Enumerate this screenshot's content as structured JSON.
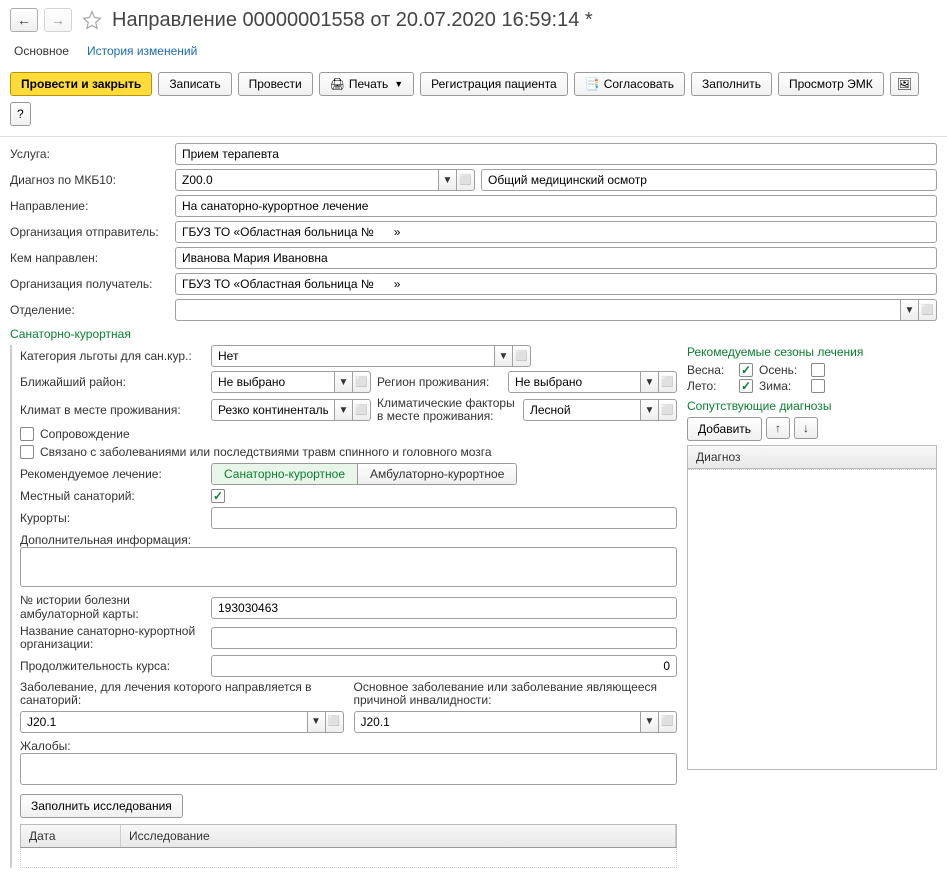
{
  "title": "Направление 00000001558 от 20.07.2020 16:59:14 *",
  "tabs": {
    "main": "Основное",
    "history": "История изменений"
  },
  "toolbar": {
    "post_close": "Провести и закрыть",
    "save": "Записать",
    "post": "Провести",
    "print": "Печать",
    "register": "Регистрация пациента",
    "approve": "Согласовать",
    "fill": "Заполнить",
    "view_emk": "Просмотр ЭМК",
    "help": "?"
  },
  "form": {
    "service_label": "Услуга:",
    "service": "Прием терапевта",
    "mkb_label": "Диагноз по МКБ10:",
    "mkb": "Z00.0",
    "mkb_desc": "Общий медицинский осмотр",
    "direction_label": "Направление:",
    "direction": "На санаторно-курортное лечение",
    "org_sender_label": "Организация отправитель:",
    "org_sender": "ГБУЗ ТО «Областная больница №      »",
    "sent_by_label": "Кем направлен:",
    "sent_by": "Иванова Мария Ивановна",
    "org_recv_label": "Организация получатель:",
    "org_recv": "ГБУЗ ТО «Областная больница №      »",
    "dept_label": "Отделение:",
    "dept": ""
  },
  "section_title": "Санаторно-курортная",
  "sk": {
    "benefit_label": "Категория льготы для сан.кур.:",
    "benefit": "Нет",
    "nearest_label": "Ближайший район:",
    "nearest": "Не выбрано",
    "region_label": "Регион проживания:",
    "region": "Не выбрано",
    "climate_label": "Климат в месте проживания:",
    "climate": "Резко континентальный",
    "factors_label": "Климатические факторы в месте проживания:",
    "factors": "Лесной",
    "escort_label": "Сопровождение",
    "spinal_label": "Связано с заболеваниями или последствиями травм спинного и головного мозга",
    "rec_treatment_label": "Рекомендуемое лечение:",
    "toggle_sk": "Санаторно-курортное",
    "toggle_ak": "Амбулаторно-курортное",
    "local_label": "Местный санаторий:",
    "resorts_label": "Курорты:",
    "resorts": "",
    "extra_label": "Дополнительная информация:",
    "extra": "",
    "history_no_label": "№ истории болезни амбулаторной карты:",
    "history_no": "193030463",
    "org_name_label": "Название санаторно-курортной организации:",
    "org_name": "",
    "duration_label": "Продолжительность курса:",
    "duration": "0",
    "disease_label": "Заболевание, для лечения которого направляется в санаторий:",
    "disease": "J20.1",
    "main_disease_label": "Основное заболевание или заболевание являющееся причиной инвалидности:",
    "main_disease": "J20.1",
    "complaints_label": "Жалобы:",
    "complaints": "",
    "fill_research": "Заполнить исследования",
    "col_date": "Дата",
    "col_research": "Исследование"
  },
  "right": {
    "seasons_title": "Рекомедуемые сезоны лечения",
    "spring": "Весна:",
    "autumn": "Осень:",
    "summer": "Лето:",
    "winter": "Зима:",
    "diag_title": "Сопутствующие диагнозы",
    "add": "Добавить",
    "diag_col": "Диагноз"
  }
}
